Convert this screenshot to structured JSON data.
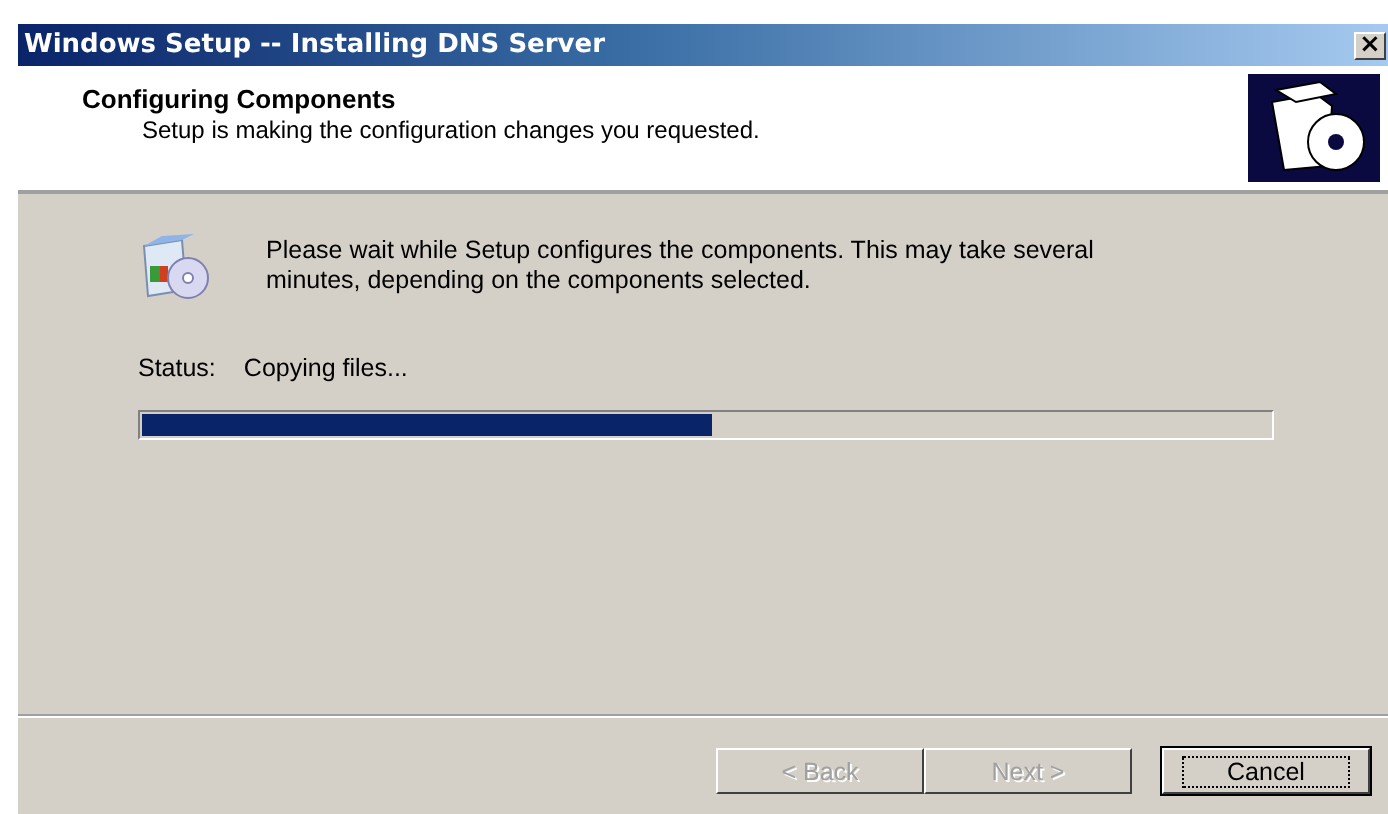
{
  "window": {
    "title": "Windows Setup -- Installing DNS Server",
    "close": "×"
  },
  "header": {
    "title": "Configuring Components",
    "subtitle": "Setup is making the configuration changes you requested."
  },
  "message": "Please wait while Setup configures the components. This may take several minutes, depending on the components selected.",
  "status": {
    "label": "Status:",
    "value": "Copying files..."
  },
  "progress": {
    "level": 0.505
  },
  "buttons": [
    {
      "label": "< Back",
      "disabled": true,
      "default": false
    },
    {
      "label": "Next >",
      "disabled": true,
      "default": false
    },
    {
      "label": "Cancel",
      "disabled": false,
      "default": true
    }
  ]
}
